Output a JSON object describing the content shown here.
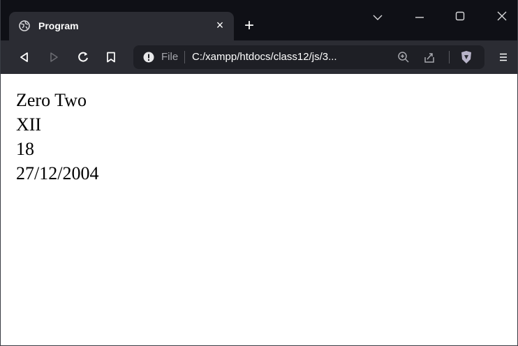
{
  "tab": {
    "title": "Program",
    "close_glyph": "×",
    "new_tab_glyph": "+"
  },
  "window_controls": {
    "dropdown": "⌄",
    "minimize": "—",
    "maximize": "☐",
    "close": "✕"
  },
  "toolbar": {
    "back_icon": "back-icon",
    "forward_icon": "forward-icon",
    "reload_icon": "reload-icon",
    "bookmark_icon": "bookmark-icon",
    "menu_icon": "hamburger-menu-icon"
  },
  "address_bar": {
    "security_label": "File",
    "url": "C:/xampp/htdocs/class12/js/3..."
  },
  "page": {
    "lines": [
      "Zero Two",
      "XII",
      "18",
      "27/12/2004"
    ]
  },
  "colors": {
    "titlebar_bg": "#0f1016",
    "tab_bg": "#2b2c33",
    "toolbar_bg": "#2b2c33",
    "urlbar_bg": "#1e1f25",
    "page_bg": "#ffffff",
    "brave_shield": "#b8b4c9"
  }
}
